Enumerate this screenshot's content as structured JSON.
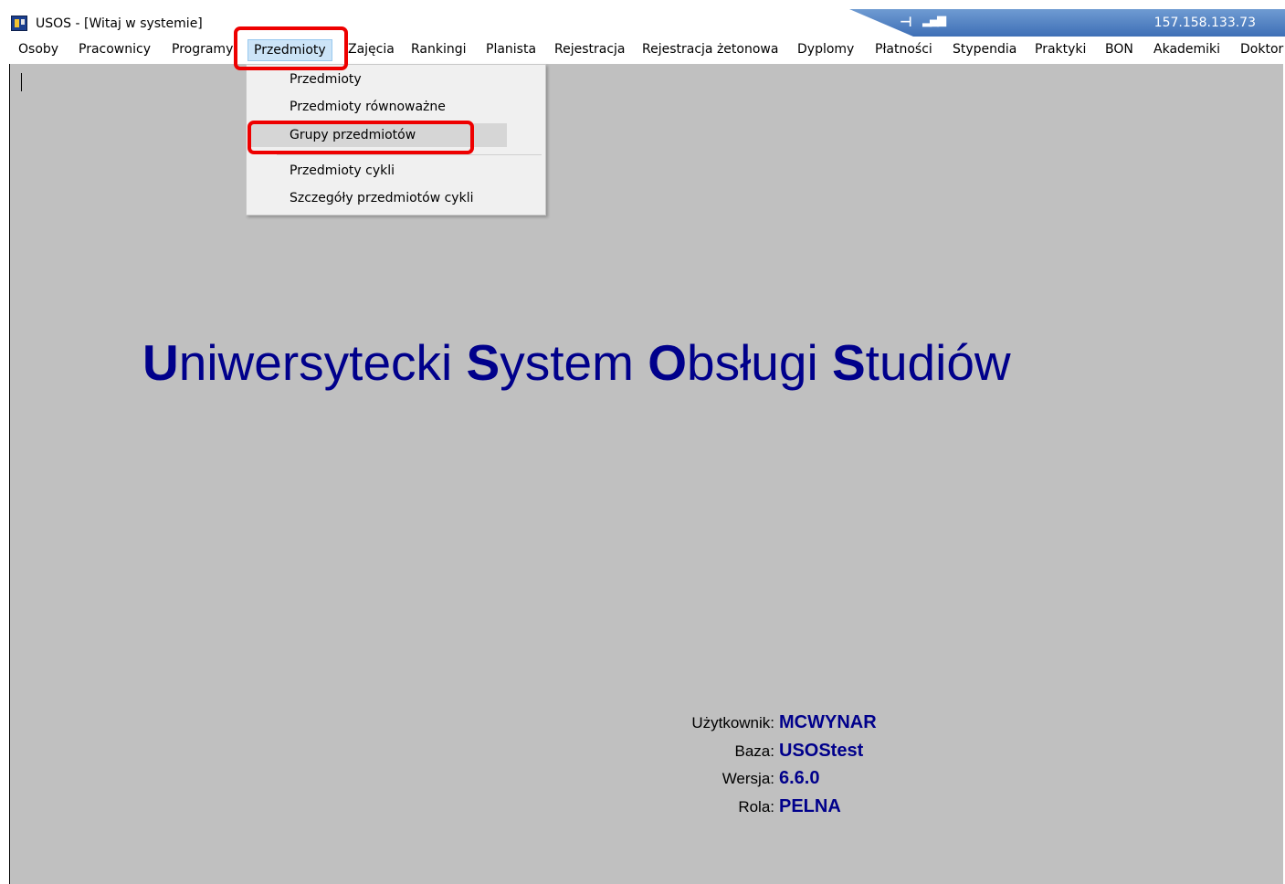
{
  "window": {
    "title": "USOS - [Witaj w systemie]",
    "connection_ip": "157.158.133.73",
    "app_icon": "usos-app-icon"
  },
  "menu": {
    "items": [
      {
        "label": "Osoby"
      },
      {
        "label": "Pracownicy"
      },
      {
        "label": "Programy"
      },
      {
        "label": "Przedmioty"
      },
      {
        "label": "Zajęcia"
      },
      {
        "label": "Rankingi"
      },
      {
        "label": "Planista"
      },
      {
        "label": "Rejestracja"
      },
      {
        "label": "Rejestracja żetonowa"
      },
      {
        "label": "Dyplomy"
      },
      {
        "label": "Płatności"
      },
      {
        "label": "Stypendia"
      },
      {
        "label": "Praktyki"
      },
      {
        "label": "BON"
      },
      {
        "label": "Akademiki"
      },
      {
        "label": "Doktor"
      }
    ],
    "active": "Przedmioty"
  },
  "dropdown": {
    "items": [
      {
        "label": "Przedmioty"
      },
      {
        "label": "Przedmioty równoważne"
      },
      {
        "label": "Grupy przedmiotów"
      },
      {
        "label": "Przedmioty cykli"
      },
      {
        "label": "Szczegóły przedmiotów cykli"
      }
    ],
    "hovered": "Grupy przedmiotów"
  },
  "heading": {
    "words": [
      {
        "initial": "U",
        "rest": "niwersytecki"
      },
      {
        "initial": "S",
        "rest": "ystem"
      },
      {
        "initial": "O",
        "rest": "bsługi"
      },
      {
        "initial": "S",
        "rest": "tudiów"
      }
    ]
  },
  "info": {
    "user_label": "Użytkownik:",
    "user_value": "MCWYNAR",
    "db_label": "Baza:",
    "db_value": "USOStest",
    "version_label": "Wersja:",
    "version_value": "6.6.0",
    "role_label": "Rola:",
    "role_value": "PELNA"
  },
  "colors": {
    "heading": "#00008b",
    "workspace": "#c0c0c0",
    "highlight": "#ee0000",
    "connection_bar": "#3e6fb6"
  }
}
